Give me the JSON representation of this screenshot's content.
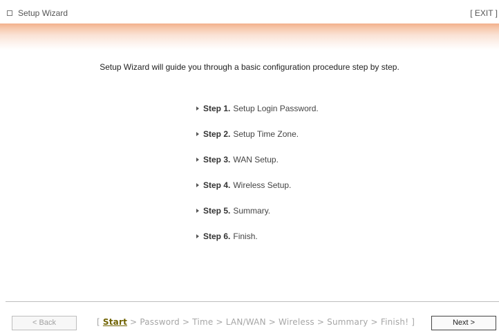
{
  "window": {
    "title": "Setup Wizard",
    "exit_label": "[ EXIT ]",
    "icon": "window-box-icon"
  },
  "intro_text": "Setup Wizard will guide you through a basic configuration procedure step by step.",
  "steps": [
    {
      "num": "Step 1.",
      "label": "Setup Login Password."
    },
    {
      "num": "Step 2.",
      "label": "Setup Time Zone."
    },
    {
      "num": "Step 3.",
      "label": "WAN Setup."
    },
    {
      "num": "Step 4.",
      "label": "Wireless Setup."
    },
    {
      "num": "Step 5.",
      "label": "Summary."
    },
    {
      "num": "Step 6.",
      "label": "Finish."
    }
  ],
  "footer": {
    "back_label": "< Back",
    "next_label": "Next >",
    "breadcrumb": {
      "open": "[ ",
      "current": "Start",
      "sep": " > ",
      "items": [
        "Password",
        "Time",
        "LAN/WAN",
        "Wireless",
        "Summary",
        "Finish!"
      ],
      "close": " ]"
    }
  },
  "colors": {
    "band_top": "#f3b08c",
    "current_crumb": "#6f6200",
    "inactive_text": "#a6a6a6"
  }
}
